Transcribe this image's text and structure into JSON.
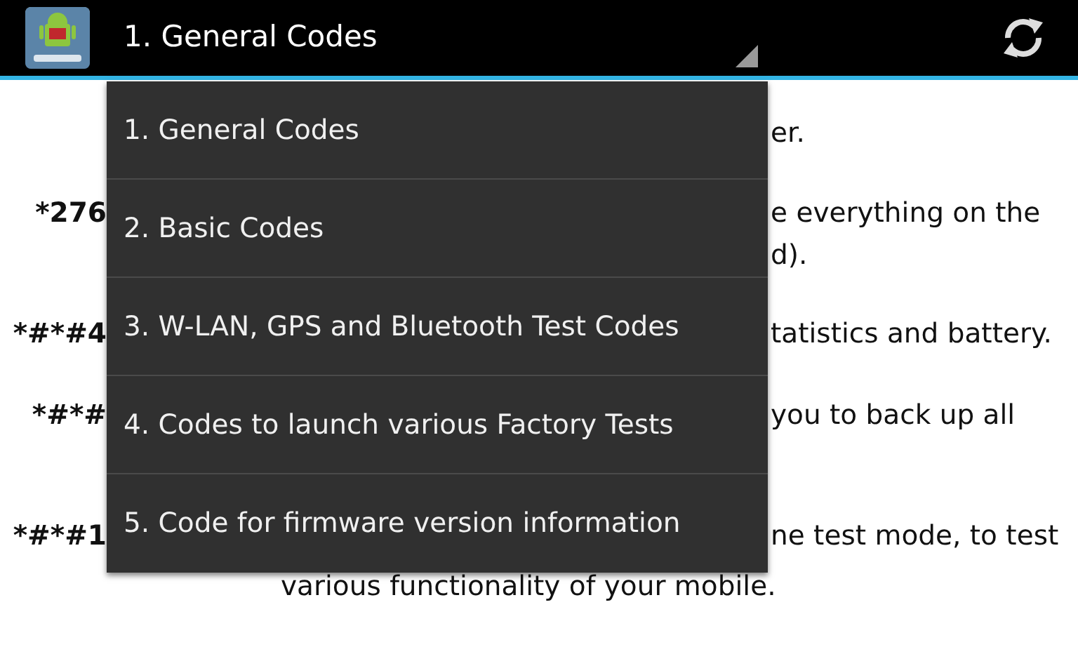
{
  "action_bar": {
    "spinner_value": "1. General Codes"
  },
  "content_lines": [
    {
      "text": "er."
    },
    {
      "code": "*276",
      "text": "e everything on the"
    },
    {
      "text": "d)."
    },
    {
      "code": "*#*#4",
      "text": "tatistics and battery."
    },
    {
      "code": "*#*#",
      "text": "you to back up all"
    },
    {
      "code": "*#*#1",
      "text": "ne test mode, to test"
    },
    {
      "kind": "full",
      "text": "various functionality of your mobile."
    }
  ],
  "dropdown": {
    "items": [
      "1. General Codes",
      "2. Basic Codes",
      "3. W-LAN, GPS and Bluetooth Test Codes",
      "4. Codes to launch various Factory Tests",
      "5. Code for firmware version information"
    ]
  }
}
